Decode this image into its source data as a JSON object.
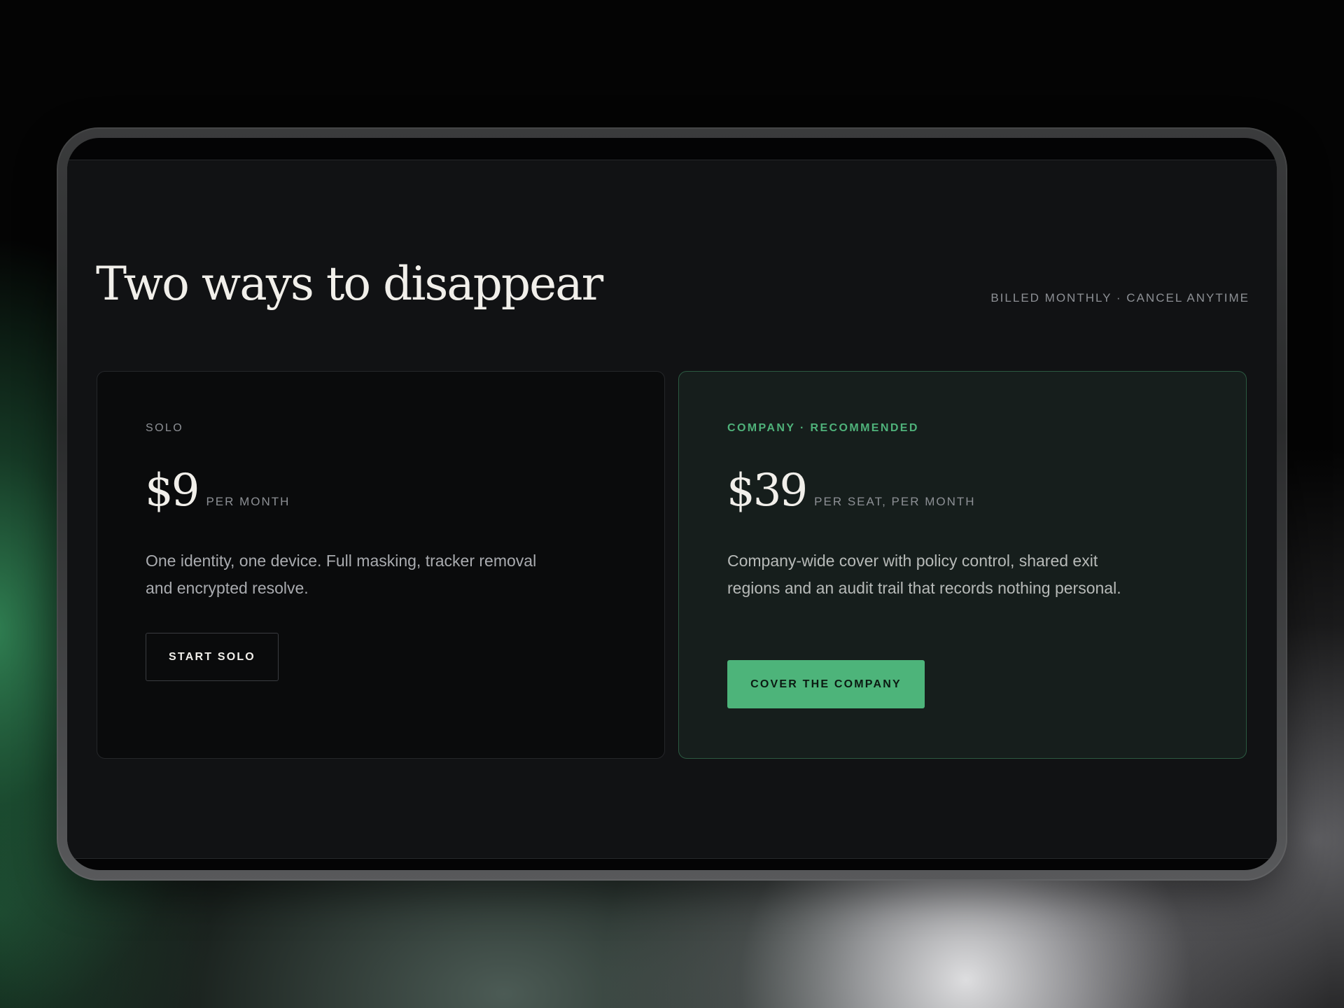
{
  "pricing": {
    "title": "Two ways to disappear",
    "billing_note": "BILLED MONTHLY · CANCEL ANYTIME",
    "plans": [
      {
        "label": "SOLO",
        "price": "$9",
        "period": "PER MONTH",
        "description": "One identity, one device. Full masking, tracker removal and encrypted resolve.",
        "cta_label": "START SOLO"
      },
      {
        "label": "COMPANY · RECOMMENDED",
        "price": "$39",
        "period": "PER SEAT, PER MONTH",
        "description": "Company-wide cover with policy control, shared exit regions and an audit trail that records nothing personal.",
        "cta_label": "COVER THE COMPANY"
      }
    ]
  },
  "colors": {
    "page_background": "#111214",
    "accent_green": "#4db47a",
    "heading_text": "#f1efea",
    "muted_text": "#8d9095"
  }
}
